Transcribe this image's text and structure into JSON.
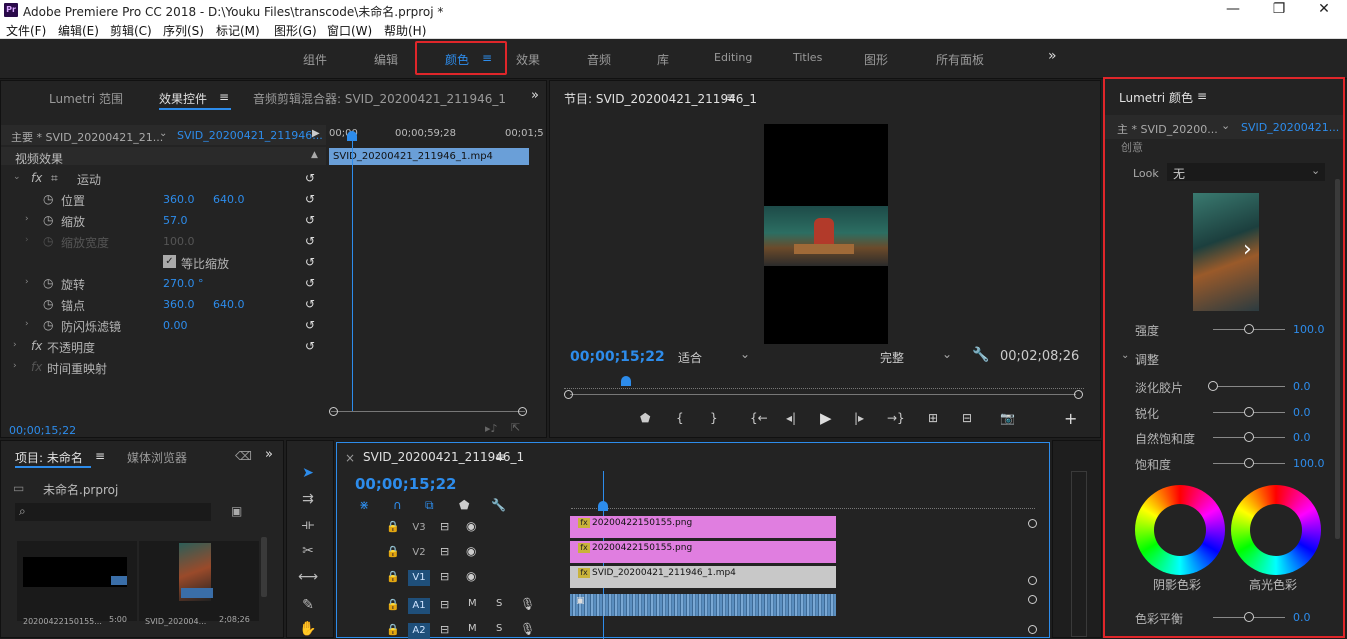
{
  "title_bar": {
    "app_icon": "Pr",
    "title": "Adobe Premiere Pro CC 2018 - D:\\Youku Files\\transcode\\未命名.prproj *",
    "minimize": "—",
    "maximize": "❐",
    "close": "✕"
  },
  "menu": [
    "文件(F)",
    "编辑(E)",
    "剪辑(C)",
    "序列(S)",
    "标记(M)",
    "图形(G)",
    "窗口(W)",
    "帮助(H)"
  ],
  "workspaces": {
    "items": [
      "组件",
      "编辑",
      "颜色",
      "效果",
      "音频",
      "库",
      "Editing",
      "Titles",
      "图形",
      "所有面板"
    ],
    "active": "颜色",
    "active_menu_icon": "≡",
    "overflow": "»"
  },
  "effect_panel": {
    "tabs": [
      "Lumetri 范围",
      "效果控件",
      "音频剪辑混合器: SVID_20200421_211946_1"
    ],
    "active_tab_menu": "≡",
    "expand_icon": "»",
    "source_label": "主要 * SVID_20200421_21...",
    "clip_label": "SVID_20200421_211946...",
    "ruler": [
      "00;00",
      "00;00;59;28",
      "00;01;5"
    ],
    "clip_bar": "SVID_20200421_211946_1.mp4",
    "section": "视频效果",
    "rows": [
      {
        "name": "运动",
        "fx": "fx",
        "values": []
      },
      {
        "name": "位置",
        "values": [
          "360.0",
          "640.0"
        ]
      },
      {
        "name": "缩放",
        "values": [
          "57.0"
        ]
      },
      {
        "name": "缩放宽度",
        "values": [
          "100.0"
        ]
      },
      {
        "name": "等比缩放",
        "values": []
      },
      {
        "name": "旋转",
        "values": [
          "270.0 °"
        ]
      },
      {
        "name": "锚点",
        "values": [
          "360.0",
          "640.0"
        ]
      },
      {
        "name": "防闪烁滤镜",
        "values": [
          "0.00"
        ]
      },
      {
        "name": "不透明度",
        "fx": "fx",
        "values": []
      },
      {
        "name": "时间重映射",
        "fx": "fx",
        "values": []
      }
    ],
    "timecode": "00;00;15;22"
  },
  "program_monitor": {
    "title": "节目: SVID_20200421_211946_1",
    "menu": "≡",
    "timecode": "00;00;15;22",
    "fit": "适合",
    "quality": "完整",
    "duration": "00;02;08;26"
  },
  "lumetri": {
    "title": "Lumetri 颜色",
    "menu": "≡",
    "source": "主 * SVID_20200...",
    "clip": "SVID_20200421...",
    "section_creative": "创意",
    "look_label": "Look",
    "look_value": "无",
    "intensity_label": "强度",
    "intensity_value": "100.0",
    "intensity_level": 0.5,
    "adjust_section": "调整",
    "sliders": [
      {
        "label": "淡化胶片",
        "value": "0.0",
        "level": 0.0
      },
      {
        "label": "锐化",
        "value": "0.0",
        "level": 0.5
      },
      {
        "label": "自然饱和度",
        "value": "0.0",
        "level": 0.5
      },
      {
        "label": "饱和度",
        "value": "100.0",
        "level": 0.5
      }
    ],
    "wheel_shadow": "阴影色彩",
    "wheel_highlight": "高光色彩",
    "balance_label": "色彩平衡",
    "balance_value": "0.0",
    "balance_level": 0.5
  },
  "project": {
    "tabs": [
      "项目: 未命名",
      "媒体浏览器"
    ],
    "tab_menu": "≡",
    "expand": "»",
    "file": "未命名.prproj",
    "items": [
      {
        "name": "20200422150155...",
        "duration": "5:00"
      },
      {
        "name": "SVID_202004...",
        "duration": "2;08;26"
      }
    ]
  },
  "timeline": {
    "title": "SVID_20200421_211946_1",
    "close": "×",
    "menu": "≡",
    "timecode": "00;00;15;22",
    "tracks": [
      {
        "name": "V3",
        "clip": "20200422150155.png",
        "type": "video"
      },
      {
        "name": "V2",
        "clip": "20200422150155.png",
        "type": "video"
      },
      {
        "name": "V1",
        "clip": "SVID_20200421_211946_1.mp4",
        "type": "video"
      },
      {
        "name": "A1",
        "type": "audio"
      },
      {
        "name": "A2",
        "type": "audio"
      }
    ],
    "m": "M",
    "s": "S"
  },
  "colors": {
    "accent": "#2d8ceb",
    "highlight_border": "#e0262a",
    "png_clip": "#e07ee0",
    "video_clip": "#c8c8c8",
    "audio_clip": "#5b8fc0"
  }
}
